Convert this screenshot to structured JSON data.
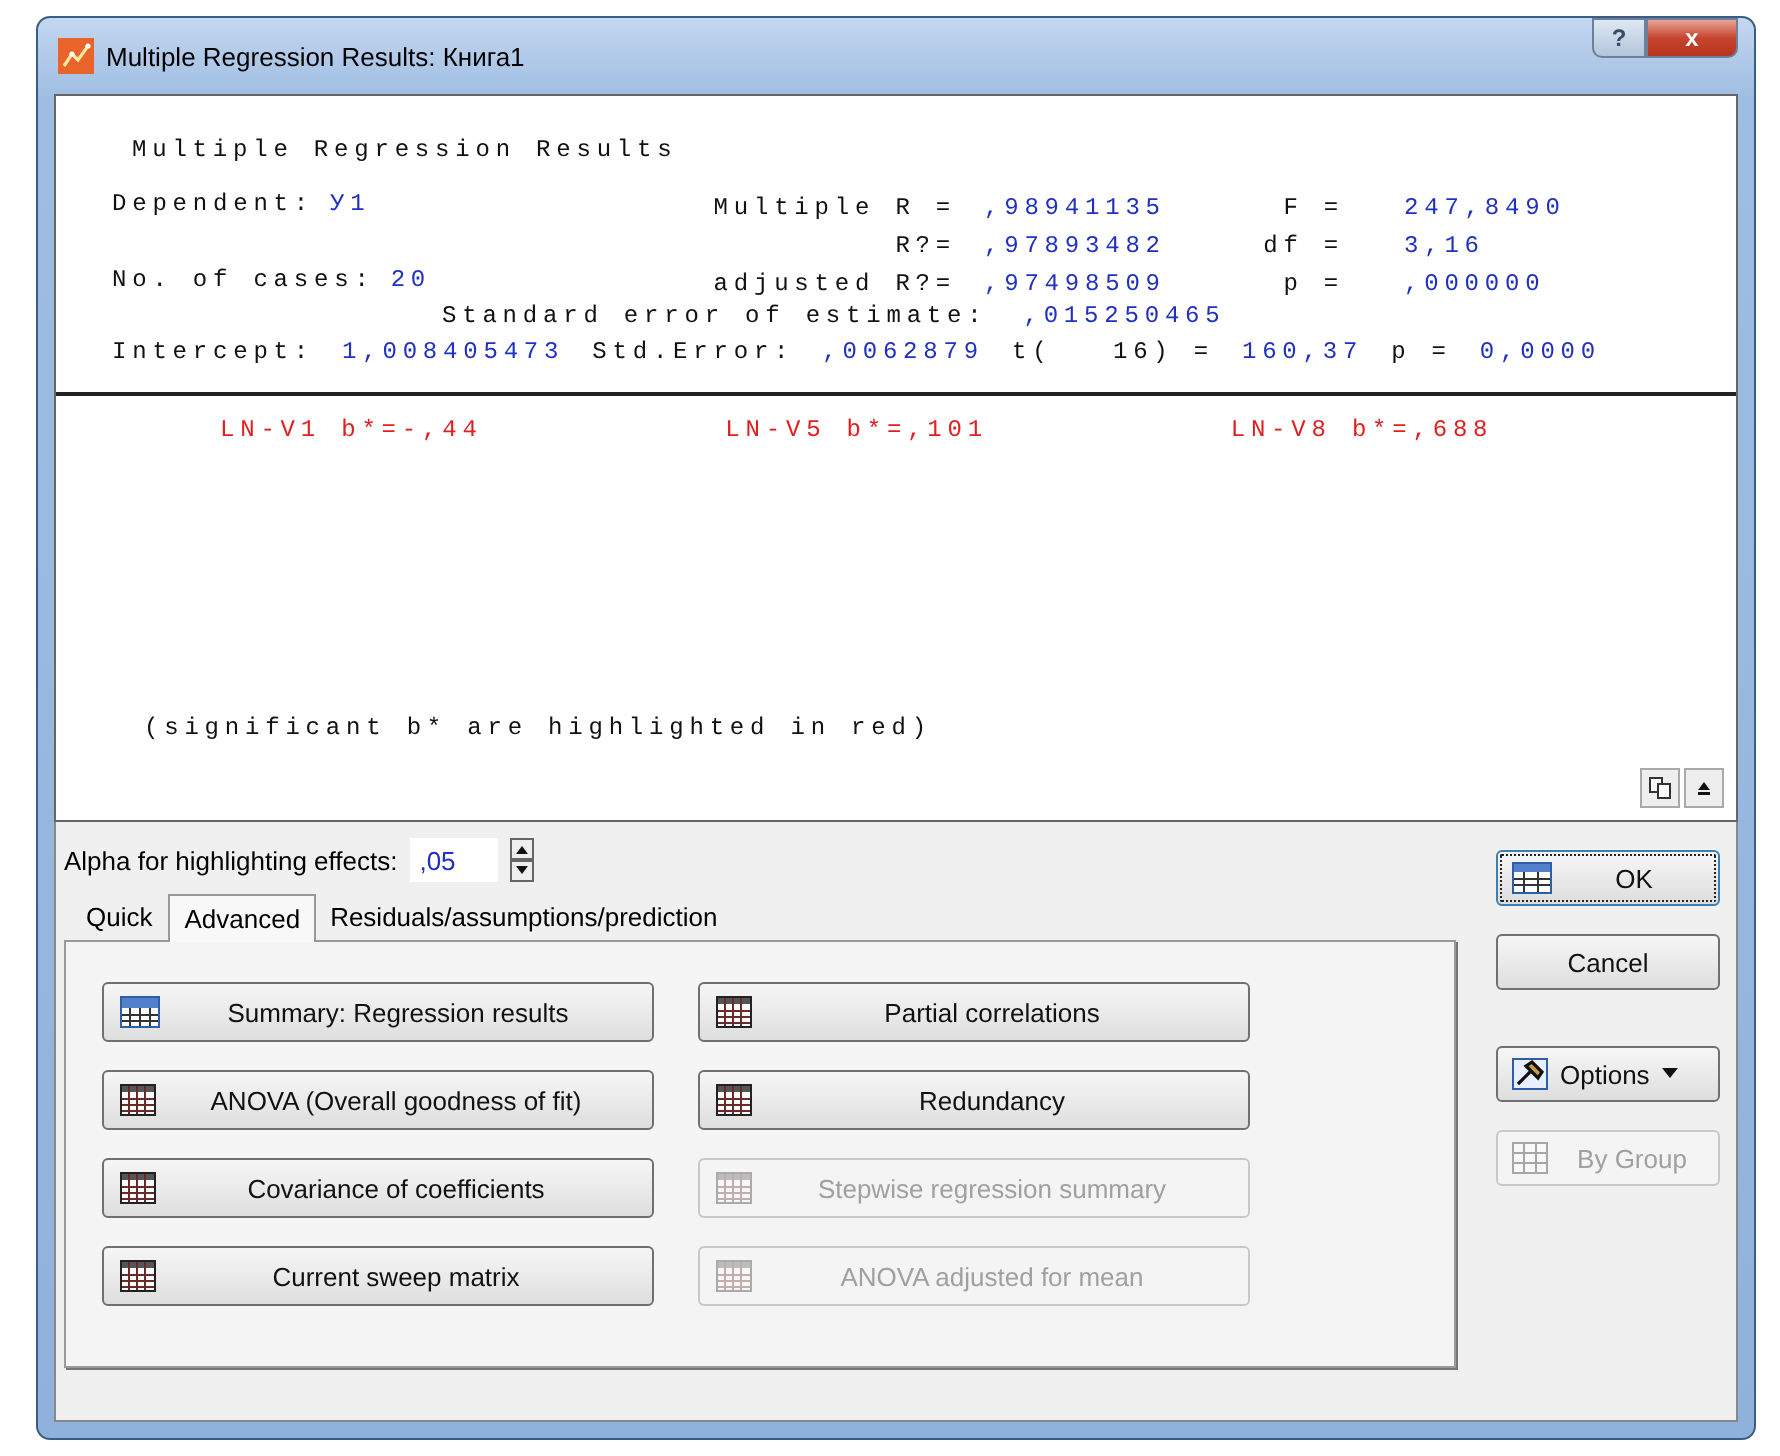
{
  "window": {
    "title": "Multiple Regression Results: Книга1",
    "buttons": [
      {
        "kind": "help",
        "label": "?"
      },
      {
        "kind": "close",
        "label": "x"
      }
    ]
  },
  "results": {
    "heading": "Multiple Regression Results",
    "rows": [
      {
        "left": {
          "label": "Dependent:",
          "value": "У1"
        },
        "middle": {
          "label": "Multiple R =",
          "value": ",98941135"
        },
        "right": {
          "label": "F =",
          "value": "247,8490"
        }
      },
      {
        "middle": {
          "label": "R?=",
          "value": ",97893482"
        },
        "right": {
          "label": "df =",
          "value": "3,16"
        }
      },
      {
        "left": {
          "label": "No. of cases:",
          "value": "20"
        },
        "middle": {
          "label": "adjusted R?=",
          "value": ",97498509"
        },
        "right": {
          "label": "p =",
          "value": ",000000"
        }
      }
    ],
    "std_error": {
      "label": "Standard error of estimate:",
      "value": ",015250465"
    },
    "intercept": [
      {
        "label": "Intercept:",
        "value": "1,008405473"
      },
      {
        "label": "Std.Error:",
        "value": ",0062879"
      },
      {
        "label": "t(   16) =",
        "value": "160,37"
      },
      {
        "label": "p =",
        "value": "0,0000"
      }
    ],
    "coefficients": [
      {
        "text": "LN-V1 b*=-,44",
        "significant": true
      },
      {
        "text": "LN-V5 b*=,101",
        "significant": true
      },
      {
        "text": "LN-V8 b*=,688",
        "significant": true
      }
    ],
    "note": "(significant b* are highlighted in red)"
  },
  "alpha": {
    "label": "Alpha for highlighting effects:",
    "value": ",05"
  },
  "tabs": [
    {
      "label": "Quick",
      "selected": false
    },
    {
      "label": "Advanced",
      "selected": true
    },
    {
      "label": "Residuals/assumptions/prediction",
      "selected": false
    }
  ],
  "actions": [
    {
      "label": "Summary:  Regression results",
      "kind": "summary",
      "disabled": false
    },
    {
      "label": "Partial correlations",
      "kind": "table",
      "disabled": false
    },
    {
      "label": "ANOVA (Overall goodness of fit)",
      "kind": "table",
      "disabled": false
    },
    {
      "label": "Redundancy",
      "kind": "table",
      "disabled": false
    },
    {
      "label": "Covariance of coefficients",
      "kind": "table",
      "disabled": false
    },
    {
      "label": "Stepwise regression summary",
      "kind": "table",
      "disabled": true
    },
    {
      "label": "Current sweep matrix",
      "kind": "table",
      "disabled": false
    },
    {
      "label": "ANOVA adjusted for mean",
      "kind": "table",
      "disabled": true
    }
  ],
  "side_buttons": [
    {
      "label": "OK",
      "kind": "ok",
      "disabled": false
    },
    {
      "label": "Cancel",
      "kind": "plain",
      "disabled": false
    },
    {
      "label": "Options",
      "kind": "menu",
      "disabled": false
    },
    {
      "label": "By Group",
      "kind": "group",
      "disabled": true
    }
  ]
}
